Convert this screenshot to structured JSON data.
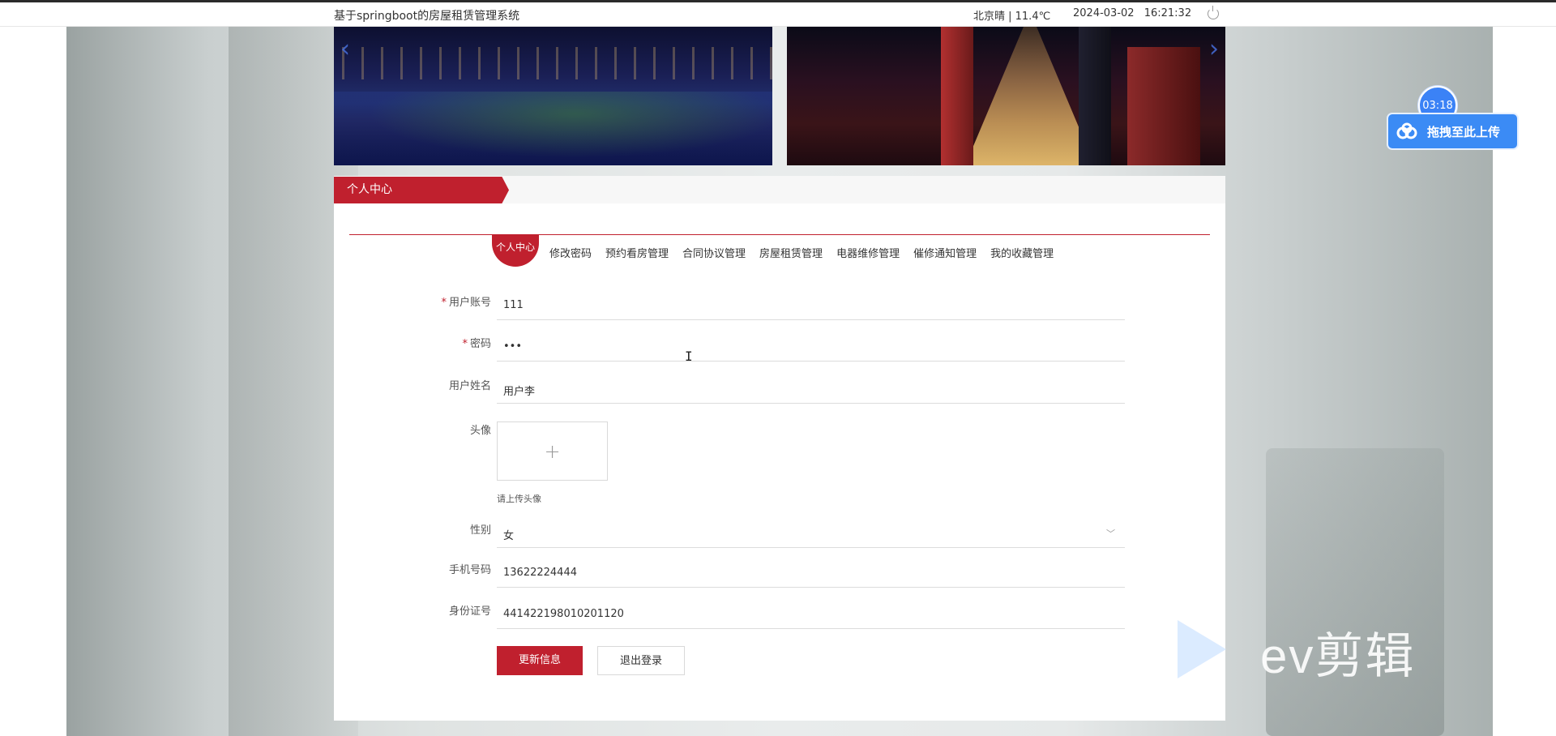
{
  "topbar": {
    "site_title": "基于springboot的房屋租赁管理系统",
    "weather": "北京晴 | 11.4℃",
    "date": "2024-03-02",
    "time": "16:21:32"
  },
  "panel": {
    "header_title": "个人中心",
    "nav": [
      {
        "label": "个人中心",
        "active": true
      },
      {
        "label": "修改密码"
      },
      {
        "label": "预约看房管理"
      },
      {
        "label": "合同协议管理"
      },
      {
        "label": "房屋租赁管理"
      },
      {
        "label": "电器维修管理"
      },
      {
        "label": "催修通知管理"
      },
      {
        "label": "我的收藏管理"
      }
    ]
  },
  "form": {
    "account": {
      "label": "用户账号",
      "required": "*",
      "value": "111"
    },
    "password": {
      "label": "密码",
      "required": "*",
      "value": "•••"
    },
    "name": {
      "label": "用户姓名",
      "value": "用户李"
    },
    "avatar": {
      "label": "头像",
      "plus": "+",
      "hint": "请上传头像"
    },
    "gender": {
      "label": "性别",
      "value": "女"
    },
    "phone": {
      "label": "手机号码",
      "value": "13622224444"
    },
    "idcard": {
      "label": "身份证号",
      "value": "441422198010201120"
    }
  },
  "buttons": {
    "update": "更新信息",
    "logout": "退出登录"
  },
  "widget": {
    "timer": "03:18",
    "upload_label": "拖拽至此上传"
  },
  "watermark": {
    "text": "ev剪辑"
  },
  "colors": {
    "accent": "#c0202e",
    "upload_blue": "#3b8bf5"
  }
}
